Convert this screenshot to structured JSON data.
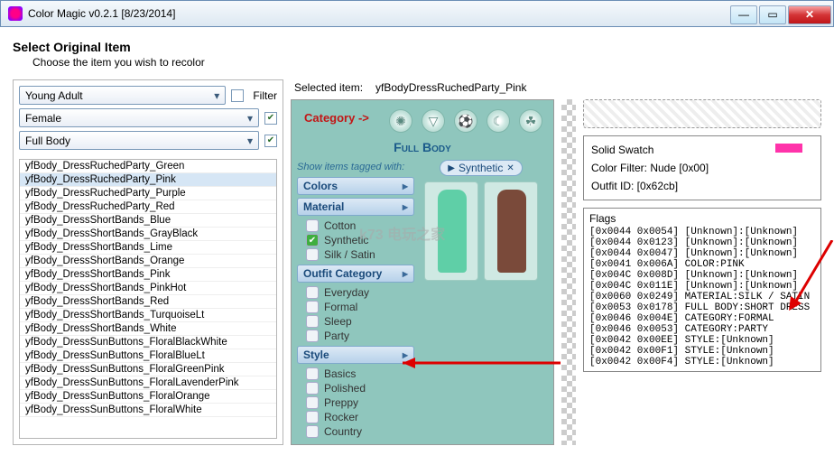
{
  "window": {
    "title": "Color Magic v0.2.1 [8/23/2014]"
  },
  "header": {
    "title": "Select Original Item",
    "subtitle": "Choose the item you wish to recolor"
  },
  "filters": {
    "age": "Young Adult",
    "gender": "Female",
    "part": "Full Body",
    "filter_label": "Filter"
  },
  "list": {
    "selected_index": 1,
    "items": [
      "yfBody_DressRuchedParty_Green",
      "yfBody_DressRuchedParty_Pink",
      "yfBody_DressRuchedParty_Purple",
      "yfBody_DressRuchedParty_Red",
      "yfBody_DressShortBands_Blue",
      "yfBody_DressShortBands_GrayBlack",
      "yfBody_DressShortBands_Lime",
      "yfBody_DressShortBands_Orange",
      "yfBody_DressShortBands_Pink",
      "yfBody_DressShortBands_PinkHot",
      "yfBody_DressShortBands_Red",
      "yfBody_DressShortBands_TurquoiseLt",
      "yfBody_DressShortBands_White",
      "yfBody_DressSunButtons_FloralBlackWhite",
      "yfBody_DressSunButtons_FloralBlueLt",
      "yfBody_DressSunButtons_FloralGreenPink",
      "yfBody_DressSunButtons_FloralLavenderPink",
      "yfBody_DressSunButtons_FloralOrange",
      "yfBody_DressSunButtons_FloralWhite"
    ]
  },
  "selected": {
    "label": "Selected item:",
    "value": "yfBodyDressRuchedParty_Pink"
  },
  "game": {
    "category_label": "Category ->",
    "fullbody": "Full Body",
    "tagged_label": "Show items tagged with:",
    "menus": {
      "colors": "Colors",
      "material": "Material",
      "outfit_cat": "Outfit Category",
      "style": "Style"
    },
    "materials": [
      "Cotton",
      "Synthetic",
      "Silk / Satin"
    ],
    "material_selected": 1,
    "outfits": [
      "Everyday",
      "Formal",
      "Sleep",
      "Party"
    ],
    "styles": [
      "Basics",
      "Polished",
      "Preppy",
      "Rocker",
      "Country"
    ],
    "pill": "Synthetic"
  },
  "swatch": {
    "title": "Solid Swatch",
    "color_filter": "Color Filter: Nude [0x00]",
    "outfit_id": "Outfit ID: [0x62cb]"
  },
  "flags": {
    "title": "Flags",
    "lines": [
      "[0x0044 0x0054] [Unknown]:[Unknown]",
      "[0x0044 0x0123] [Unknown]:[Unknown]",
      "[0x0044 0x0047] [Unknown]:[Unknown]",
      "[0x0041 0x006A] COLOR:PINK",
      "[0x004C 0x008D] [Unknown]:[Unknown]",
      "[0x004C 0x011E] [Unknown]:[Unknown]",
      "[0x0060 0x0249] MATERIAL:SILK / SATIN",
      "[0x0053 0x0178] FULL BODY:SHORT DRESS",
      "[0x0046 0x004E] CATEGORY:FORMAL",
      "[0x0046 0x0053] CATEGORY:PARTY",
      "[0x0042 0x00EE] STYLE:[Unknown]",
      "[0x0042 0x00F1] STYLE:[Unknown]",
      "[0x0042 0x00F4] STYLE:[Unknown]"
    ]
  }
}
